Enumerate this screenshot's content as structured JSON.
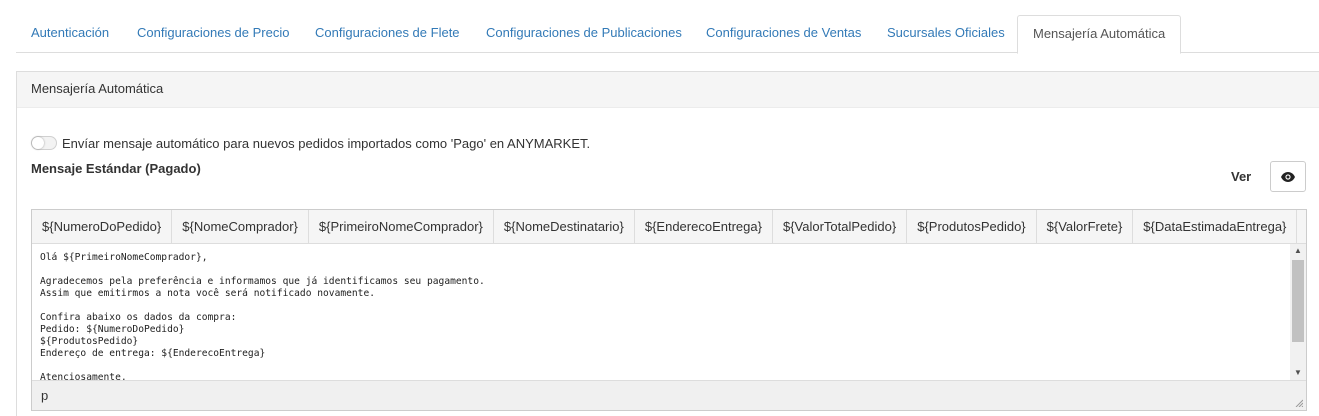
{
  "tabs": [
    {
      "label": "Autenticación"
    },
    {
      "label": "Configuraciones de Precio"
    },
    {
      "label": "Configuraciones de Flete"
    },
    {
      "label": "Configuraciones de Publicaciones"
    },
    {
      "label": "Configuraciones de Ventas"
    },
    {
      "label": "Sucursales Oficiales"
    },
    {
      "label": "Mensajería Automática",
      "active": true
    }
  ],
  "panel": {
    "heading": "Mensajería Automática",
    "toggle_label": "Envíar mensaje automático para nuevos pedidos importados como 'Pago' en ANYMARKET.",
    "toggle_on": false,
    "standard_title": "Mensaje Estándar (Pagado)",
    "ver_label": "Ver",
    "ver_icon": "eye-icon"
  },
  "editor": {
    "variables": [
      "${NumeroDoPedido}",
      "${NomeComprador}",
      "${PrimeiroNomeComprador}",
      "${NomeDestinatario}",
      "${EnderecoEntrega}",
      "${ValorTotalPedido}",
      "${ProdutosPedido}",
      "${ValorFrete}",
      "${DataEstimadaEntrega}"
    ],
    "content": "Olá ${PrimeiroNomeComprador},\n\nAgradecemos pela preferência e informamos que já identificamos seu pagamento.\nAssim que emitirmos a nota você será notificado novamente.\n\nConfira abaixo os dados da compra:\nPedido: ${NumeroDoPedido}\n${ProdutosPedido}\nEndereço de entrega: ${EnderecoEntrega}\n\nAtenciosamente,",
    "status_path": "p"
  },
  "colors": {
    "link": "#337ab7",
    "panel_heading_bg": "#f5f5f5",
    "border": "#dddddd"
  }
}
